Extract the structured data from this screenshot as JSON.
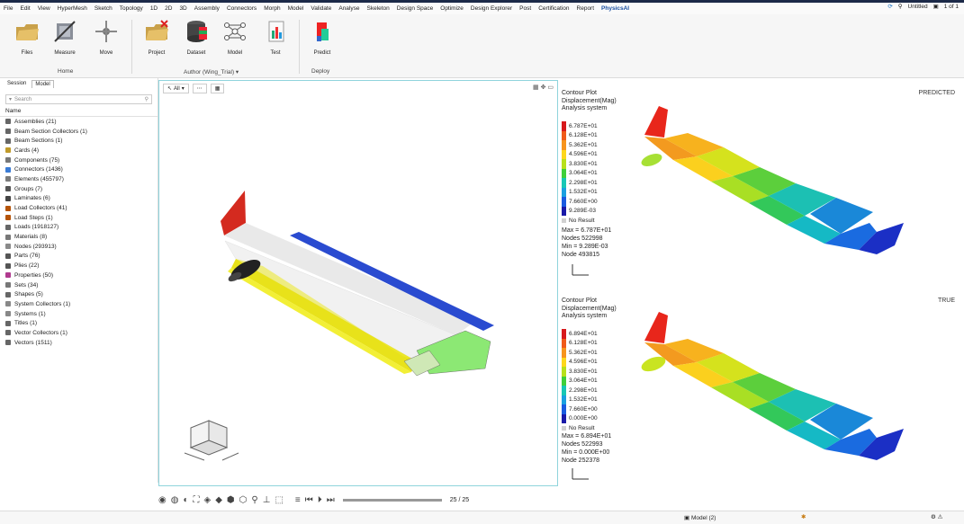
{
  "menu": [
    "File",
    "Edit",
    "View",
    "HyperMesh",
    "Sketch",
    "Topology",
    "1D",
    "2D",
    "3D",
    "Assembly",
    "Connectors",
    "Morph",
    "Model",
    "Validate",
    "Analyse",
    "Skeleton",
    "Design Space",
    "Optimize",
    "Design Explorer",
    "Post",
    "Certification",
    "Report",
    "PhysicsAI"
  ],
  "menu_active": "PhysicsAI",
  "menu_right": {
    "session": "Untitled",
    "page": "1 of 1"
  },
  "ribbon": {
    "tools": [
      {
        "label": "Files",
        "icon": "folder-icon"
      },
      {
        "label": "Measure",
        "icon": "measure-icon"
      },
      {
        "label": "Move",
        "icon": "move-icon"
      },
      {
        "label": "Project",
        "icon": "project-icon"
      },
      {
        "label": "Dataset",
        "icon": "dataset-icon"
      },
      {
        "label": "Model",
        "icon": "model-icon"
      },
      {
        "label": "Test",
        "icon": "test-icon"
      },
      {
        "label": "Predict",
        "icon": "predict-icon"
      }
    ],
    "groups": {
      "home": "Home",
      "author": "Author (Wing_Trial)",
      "deploy": "Deploy"
    }
  },
  "browser": {
    "tabs": [
      "Session",
      "Model"
    ],
    "active_tab": "Model",
    "search_placeholder": "Search",
    "header": "Name",
    "items": [
      "Assemblies (21)",
      "Beam Section Collectors (1)",
      "Beam Sections (1)",
      "Cards (4)",
      "Components (75)",
      "Connectors (1436)",
      "Elements (455797)",
      "Groups (7)",
      "Laminates (6)",
      "Load Collectors (41)",
      "Load Steps (1)",
      "Loads (1918127)",
      "Materials (8)",
      "Nodes (293913)",
      "Parts (76)",
      "Plies (22)",
      "Properties (50)",
      "Sets (34)",
      "Shapes (5)",
      "System Collectors (1)",
      "Systems (1)",
      "Titles (1)",
      "Vector Collectors (1)",
      "Vectors (1511)"
    ]
  },
  "viewport": {
    "filter": "All"
  },
  "contours": [
    {
      "label": "PREDICTED",
      "title": [
        "Contour Plot",
        "Displacement(Mag)",
        "Analysis system"
      ],
      "legend": [
        "6.787E+01",
        "6.128E+01",
        "5.362E+01",
        "4.596E+01",
        "3.830E+01",
        "3.064E+01",
        "2.298E+01",
        "1.532E+01",
        "7.660E+00",
        "9.289E-03"
      ],
      "no_result": "No Result",
      "stats": [
        "Max = 6.787E+01",
        "Nodes 522998",
        "Min = 9.289E-03",
        "Node 493815"
      ]
    },
    {
      "label": "TRUE",
      "title": [
        "Contour Plot",
        "Displacement(Mag)",
        "Analysis system"
      ],
      "legend": [
        "6.894E+01",
        "6.128E+01",
        "5.362E+01",
        "4.596E+01",
        "3.830E+01",
        "3.064E+01",
        "2.298E+01",
        "1.532E+01",
        "7.660E+00",
        "0.000E+00"
      ],
      "no_result": "No Result",
      "stats": [
        "Max = 6.894E+01",
        "Nodes 522993",
        "Min = 0.000E+00",
        "Node 252378"
      ]
    }
  ],
  "legend_colors": [
    "#d7191c",
    "#f05a1a",
    "#f7941d",
    "#fdd71c",
    "#b8e01b",
    "#3fcf3a",
    "#18c7b5",
    "#1aa0e0",
    "#1a5be0",
    "#1a1aa8"
  ],
  "playback": {
    "frame": "25 / 25"
  },
  "status": {
    "model": "Model (2)"
  }
}
